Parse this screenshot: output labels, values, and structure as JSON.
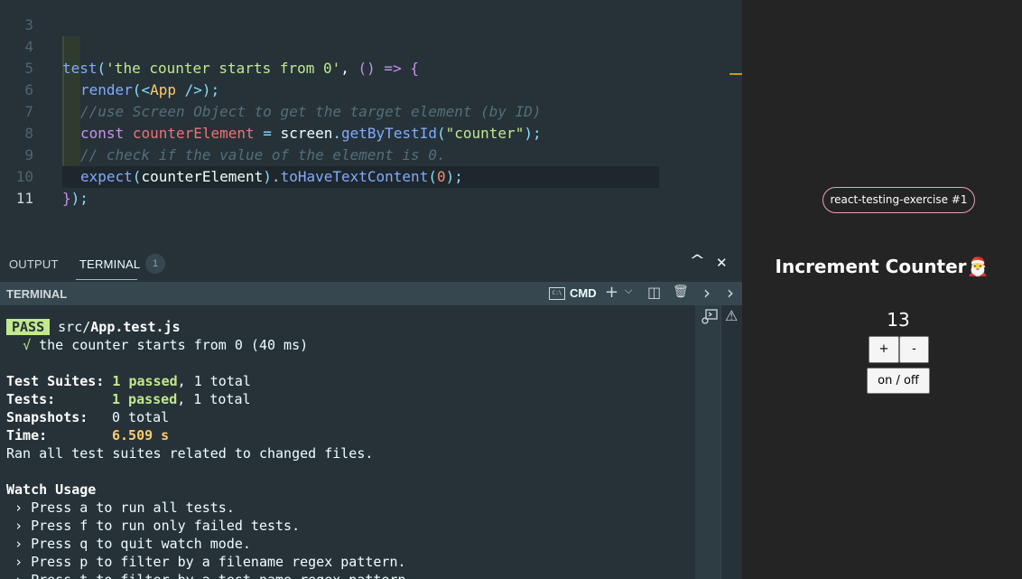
{
  "editor": {
    "line_numbers": [
      "3",
      "4",
      "5",
      "6",
      "7",
      "8",
      "9",
      "10",
      "11"
    ],
    "line4": {
      "fn": "test",
      "open": "(",
      "str": "'the counter starts from 0'",
      "sep": ", ",
      "paren": "()",
      "arrow": " => ",
      "brace": "{"
    },
    "line5": {
      "fn": "render",
      "open": "(",
      "lt": "<",
      "tag": "App",
      "close": " />",
      "end": ");"
    },
    "line6": {
      "comment": "//use Screen Object to get the target element (by ID)"
    },
    "line7": {
      "kw": "const",
      "var": "counterElement",
      "eq": " = ",
      "obj": "screen",
      "dot": ".",
      "fn": "getByTestId",
      "open": "(",
      "str": "\"counter\"",
      "end": ");"
    },
    "line8": {
      "comment": "// check if the value of the element is 0."
    },
    "line9": {
      "fn": "expect",
      "open": "(",
      "arg": "counterElement",
      "close": ").",
      "fn2": "toHaveTextContent",
      "open2": "(",
      "num": "0",
      "end": ");"
    },
    "line10": {
      "brace": "}",
      "paren": ")",
      "semi": ";"
    }
  },
  "panel": {
    "tabs": {
      "output": "OUTPUT",
      "terminal": "TERMINAL",
      "terminal_count": "1"
    },
    "header": {
      "title": "TERMINAL",
      "shell_label": "CMD",
      "shell_icon_text": "C:\\"
    },
    "controls": {
      "maximize_glyph": "^",
      "close_glyph": "✕",
      "add_glyph": "+",
      "dropdown_glyph": "⌵",
      "split_glyph": "◫",
      "trash_glyph": "🗑",
      "chevron_glyph": "›",
      "warning_glyph": "⚠"
    }
  },
  "terminal": {
    "pass_badge": "PASS",
    "file_dir": "src/",
    "file_name": "App.test.js",
    "check_mark": "√",
    "test_result_line": "the counter starts from 0 (40 ms)",
    "suites_label": "Test Suites:",
    "suites_passed": "1 passed",
    "suites_total": ", 1 total",
    "tests_label": "Tests:",
    "tests_passed": "1 passed",
    "tests_total": ", 1 total",
    "snapshots_label": "Snapshots:",
    "snapshots_value": "0 total",
    "time_label": "Time:",
    "time_value": "6.509 s",
    "ran_line": "Ran all test suites related to changed files.",
    "watch_usage_title": "Watch Usage",
    "watch_items": [
      " › Press a to run all tests.",
      " › Press f to run only failed tests.",
      " › Press q to quit watch mode.",
      " › Press p to filter by a filename regex pattern.",
      " › Press t to filter by a test name regex pattern."
    ]
  },
  "preview": {
    "project_badge": "react-testing-exercise #1",
    "title": "Increment Counter🎅",
    "counter_value": "13",
    "increment_label": "+",
    "decrement_label": "-",
    "toggle_label": "on / off"
  }
}
